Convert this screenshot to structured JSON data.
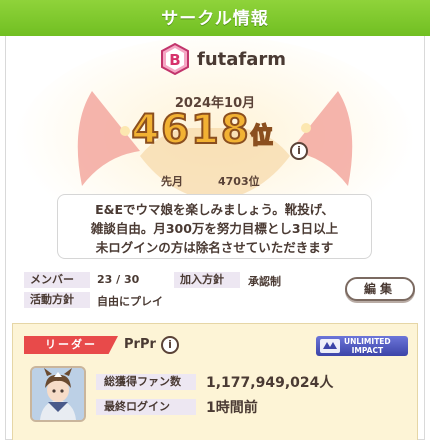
{
  "header": {
    "title": "サークル情報"
  },
  "circle": {
    "rank_letter": "B",
    "name": "futafarm",
    "month": "2024年10月",
    "rank_number": "4618",
    "rank_suffix": "位",
    "info_glyph": "i",
    "prev_label": "先月",
    "prev_rank": "4703位",
    "description": [
      "E&Eでウマ娘を楽しみましょう。靴投げ、",
      "雑談自由。月300万を努力目標とし3日以上",
      "未ログインの方は除名させていただきます"
    ]
  },
  "fields": {
    "member_label": "メンバー",
    "member_value": "23 / 30",
    "join_label": "加入方針",
    "join_value": "承認制",
    "activity_label": "活動方針",
    "activity_value": "自由にプレイ"
  },
  "edit_button": {
    "label": "編集"
  },
  "leader": {
    "tab_label": "リーダー",
    "name": "PrPr",
    "info_glyph": "i",
    "badge_line1": "UNLIMITED",
    "badge_line2": "IMPACT",
    "fans_label": "総獲得ファン数",
    "fans_value": "1,177,949,024人",
    "login_label": "最終ログイン",
    "login_value": "1時間前"
  },
  "colors": {
    "header_green": "#79c52a",
    "rank_gold": "#f2b233",
    "leader_red": "#e84a4a",
    "card_cream": "#fdf4d6"
  }
}
